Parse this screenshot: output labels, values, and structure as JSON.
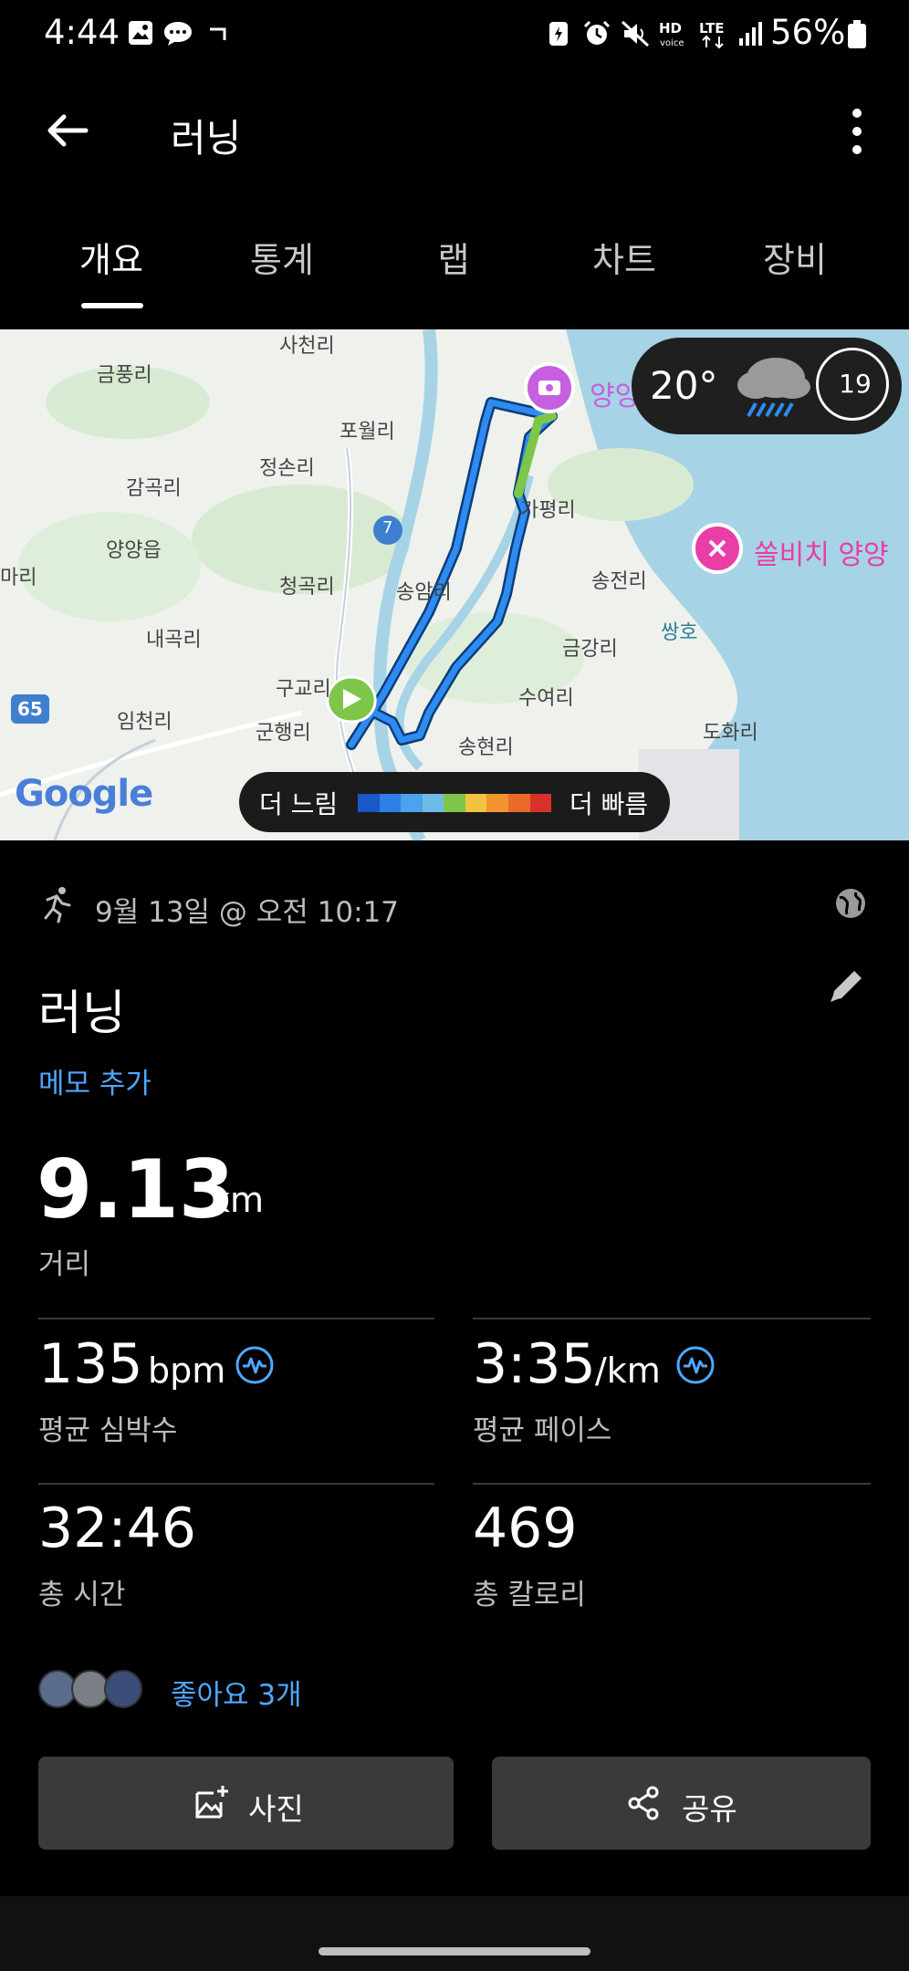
{
  "status_bar": {
    "time": "4:44",
    "battery_percent": "56%"
  },
  "app_bar": {
    "title": "러닝"
  },
  "tabs": [
    {
      "label": "개요",
      "active": true
    },
    {
      "label": "통계",
      "active": false
    },
    {
      "label": "랩",
      "active": false
    },
    {
      "label": "차트",
      "active": false
    },
    {
      "label": "장비",
      "active": false
    }
  ],
  "map": {
    "labels": [
      "사천리",
      "금풍리",
      "포월리",
      "정손리",
      "감곡리",
      "가평리",
      "양양읍",
      "청곡리",
      "송암리",
      "송전리",
      "마리",
      "내곡리",
      "금강리",
      "구교리",
      "수여리",
      "임천리",
      "군행리",
      "송현리",
      "도화리",
      "쌍호",
      "쏠비치 양양",
      "양양",
      "7",
      "65"
    ],
    "attribution": "Google",
    "weather": {
      "temperature": "20°",
      "value": "19"
    },
    "legend": {
      "slow": "더 느림",
      "fast": "더 빠름",
      "colors": [
        "#1a57c8",
        "#2d7ee6",
        "#4aa3ec",
        "#6fbbe8",
        "#7ec64a",
        "#f0c340",
        "#f2952f",
        "#ea6a2a",
        "#d9302a"
      ]
    },
    "route_colors": {
      "main": "#1f8aea",
      "fast_segment": "#7ec64a",
      "start_marker": "#7ec64a",
      "poi": "#e83ea6"
    }
  },
  "activity": {
    "date_time": "9월 13일 @ 오전 10:17",
    "name": "러닝",
    "add_memo": "메모 추가",
    "distance": {
      "value": "9.13",
      "unit": "km",
      "label": "거리"
    },
    "stats": {
      "avg_hr": {
        "value": "135",
        "unit": "bpm",
        "label": "평균 심박수"
      },
      "avg_pace": {
        "value": "3:35",
        "unit": "/km",
        "label": "평균 페이스"
      },
      "total_time": {
        "value": "32:46",
        "label": "총 시간"
      },
      "total_calories": {
        "value": "469",
        "label": "총 칼로리"
      }
    },
    "likes": "좋아요 3개"
  },
  "buttons": {
    "photo": "사진",
    "share": "공유"
  },
  "colors": {
    "accent": "#4ea8ff",
    "background": "#000000",
    "button_bg": "#3a3a3a"
  }
}
